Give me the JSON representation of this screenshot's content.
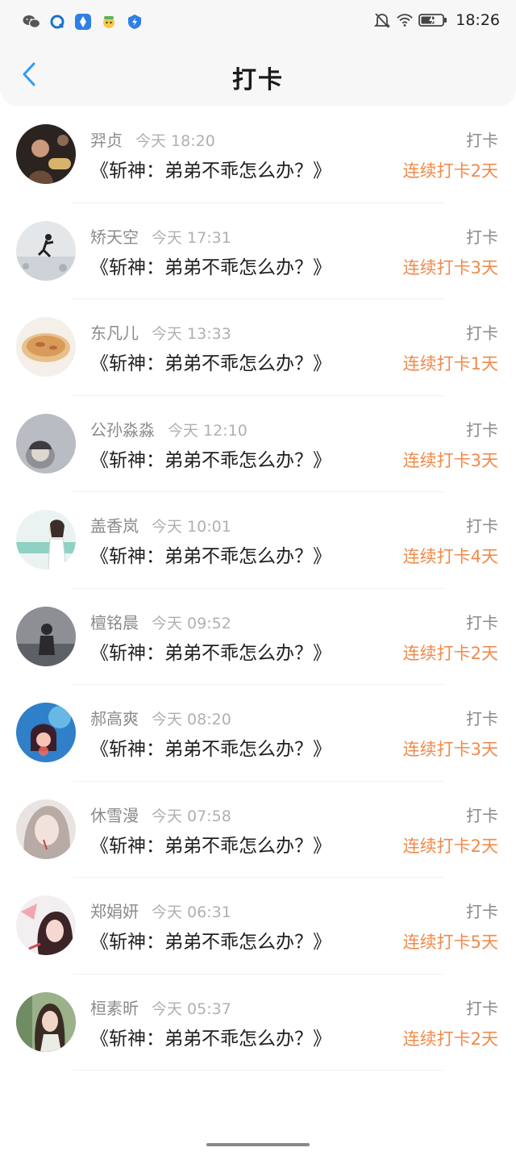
{
  "status_bar": {
    "time": "18:26",
    "left_icons": [
      "wechat-icon",
      "qq-browser-icon",
      "baidu-netdisk-icon",
      "emoji-app-icon",
      "shield-app-icon"
    ],
    "right_icons": [
      "mute-bell-icon",
      "wifi-icon",
      "battery-charging-icon"
    ]
  },
  "header": {
    "title": "打卡",
    "back_icon": "chevron-left-icon"
  },
  "colors": {
    "accent_back": "#2f9bf0",
    "streak_text": "#f08a4a",
    "name_text": "#8a8a8a",
    "time_text": "#b0b0b0"
  },
  "checkins": [
    {
      "name": "羿贞",
      "time": "今天 18:20",
      "book": "《斩神：弟弟不乖怎么办？》",
      "tag": "打卡",
      "streak": "连续打卡2天",
      "avatar": "avatar-icon"
    },
    {
      "name": "矫天空",
      "time": "今天 17:31",
      "book": "《斩神：弟弟不乖怎么办？》",
      "tag": "打卡",
      "streak": "连续打卡3天",
      "avatar": "avatar-icon"
    },
    {
      "name": "东凡儿",
      "time": "今天 13:33",
      "book": "《斩神：弟弟不乖怎么办？》",
      "tag": "打卡",
      "streak": "连续打卡1天",
      "avatar": "avatar-icon"
    },
    {
      "name": "公孙淼淼",
      "time": "今天 12:10",
      "book": "《斩神：弟弟不乖怎么办？》",
      "tag": "打卡",
      "streak": "连续打卡3天",
      "avatar": "avatar-icon"
    },
    {
      "name": "盖香岚",
      "time": "今天 10:01",
      "book": "《斩神：弟弟不乖怎么办？》",
      "tag": "打卡",
      "streak": "连续打卡4天",
      "avatar": "avatar-icon"
    },
    {
      "name": "檀铭晨",
      "time": "今天 09:52",
      "book": "《斩神：弟弟不乖怎么办？》",
      "tag": "打卡",
      "streak": "连续打卡2天",
      "avatar": "avatar-icon"
    },
    {
      "name": "郝高爽",
      "time": "今天 08:20",
      "book": "《斩神：弟弟不乖怎么办？》",
      "tag": "打卡",
      "streak": "连续打卡3天",
      "avatar": "avatar-icon"
    },
    {
      "name": "休雪漫",
      "time": "今天 07:58",
      "book": "《斩神：弟弟不乖怎么办？》",
      "tag": "打卡",
      "streak": "连续打卡2天",
      "avatar": "avatar-icon"
    },
    {
      "name": "郑娟妍",
      "time": "今天 06:31",
      "book": "《斩神：弟弟不乖怎么办？》",
      "tag": "打卡",
      "streak": "连续打卡5天",
      "avatar": "avatar-icon"
    },
    {
      "name": "桓素昕",
      "time": "今天 05:37",
      "book": "《斩神：弟弟不乖怎么办？》",
      "tag": "打卡",
      "streak": "连续打卡2天",
      "avatar": "avatar-icon"
    }
  ]
}
